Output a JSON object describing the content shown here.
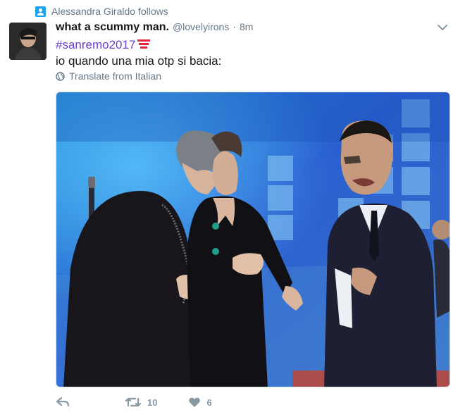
{
  "context": {
    "text": "Alessandra Giraldo follows",
    "icon": "follow-person-icon"
  },
  "tweet": {
    "author_name": "what a scummy man.",
    "handle": "@lovelyirons",
    "separator": "·",
    "time": "8m",
    "hashtag": "#sanremo2017",
    "hashtag_emoji": "sanremo-flag-icon",
    "text": "io quando una mia otp si bacia:",
    "translate_label": "Translate from Italian"
  },
  "actions": {
    "reply_icon": "reply-icon",
    "retweet_icon": "retweet-icon",
    "retweet_count": "10",
    "like_icon": "heart-icon",
    "like_count": "6"
  },
  "colors": {
    "accent": "#1da1f2",
    "hashtag": "#6a3fcf",
    "muted": "#657786",
    "action_gray": "#8899a6"
  }
}
